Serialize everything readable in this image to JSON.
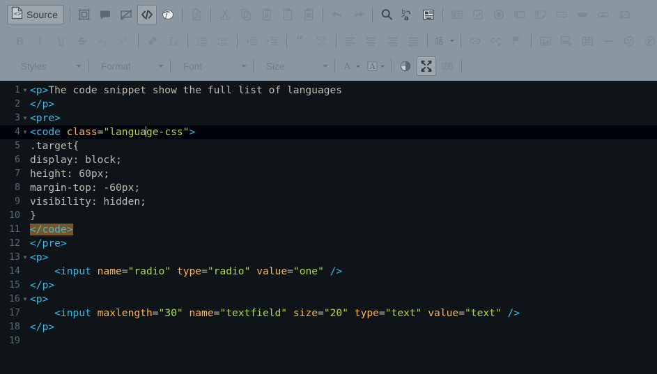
{
  "toolbar": {
    "source_button": {
      "label": "Source",
      "icon": "source-code-page-icon"
    },
    "row1": [
      {
        "name": "templates-icon",
        "state": "normal"
      },
      {
        "name": "comment-icon",
        "state": "normal"
      },
      {
        "name": "hide-comment-icon",
        "state": "normal"
      },
      {
        "name": "code-snippet-icon",
        "state": "active"
      },
      {
        "name": "mathjax-icon",
        "state": "normal"
      },
      {
        "name": "new-page-icon",
        "state": "disabled"
      },
      {
        "name": "cut-icon",
        "state": "disabled"
      },
      {
        "name": "copy-icon",
        "state": "disabled"
      },
      {
        "name": "paste-icon",
        "state": "disabled"
      },
      {
        "name": "paste-as-text-icon",
        "state": "disabled"
      },
      {
        "name": "paste-from-word-icon",
        "state": "disabled"
      },
      {
        "name": "undo-icon",
        "state": "disabled"
      },
      {
        "name": "redo-icon",
        "state": "disabled"
      },
      {
        "name": "find-icon",
        "state": "normal"
      },
      {
        "name": "replace-icon",
        "state": "normal"
      },
      {
        "name": "select-all-icon",
        "state": "normal"
      },
      {
        "name": "form-icon",
        "state": "disabled"
      },
      {
        "name": "checkbox-icon",
        "state": "disabled"
      },
      {
        "name": "radio-button-icon",
        "state": "disabled"
      },
      {
        "name": "text-field-icon",
        "state": "disabled"
      },
      {
        "name": "textarea-icon",
        "state": "disabled"
      },
      {
        "name": "select-field-icon",
        "state": "disabled"
      },
      {
        "name": "button-icon",
        "state": "disabled"
      },
      {
        "name": "image-button-icon",
        "state": "disabled"
      },
      {
        "name": "hidden-field-icon",
        "state": "disabled"
      }
    ],
    "row2": [
      {
        "name": "bold-icon",
        "label": "B",
        "state": "disabled"
      },
      {
        "name": "italic-icon",
        "label": "I",
        "state": "disabled"
      },
      {
        "name": "underline-icon",
        "label": "U",
        "state": "disabled"
      },
      {
        "name": "strikethrough-icon",
        "label": "S",
        "state": "disabled"
      },
      {
        "name": "subscript-icon",
        "state": "disabled"
      },
      {
        "name": "superscript-icon",
        "state": "disabled"
      },
      {
        "name": "copy-formatting-icon",
        "state": "disabled"
      },
      {
        "name": "remove-format-icon",
        "state": "disabled"
      },
      {
        "name": "numbered-list-icon",
        "state": "disabled"
      },
      {
        "name": "bulleted-list-icon",
        "state": "disabled"
      },
      {
        "name": "decrease-indent-icon",
        "state": "disabled"
      },
      {
        "name": "increase-indent-icon",
        "state": "disabled"
      },
      {
        "name": "blockquote-icon",
        "state": "disabled"
      },
      {
        "name": "create-div-icon",
        "state": "disabled"
      },
      {
        "name": "align-left-icon",
        "state": "disabled"
      },
      {
        "name": "align-center-icon",
        "state": "disabled"
      },
      {
        "name": "align-right-icon",
        "state": "disabled"
      },
      {
        "name": "justify-icon",
        "state": "disabled"
      },
      {
        "name": "language-icon",
        "state": "disabled"
      },
      {
        "name": "link-icon",
        "state": "disabled"
      },
      {
        "name": "unlink-icon",
        "state": "disabled"
      },
      {
        "name": "anchor-icon",
        "state": "disabled"
      },
      {
        "name": "image-icon",
        "state": "disabled"
      },
      {
        "name": "insert-media-icon",
        "state": "disabled"
      },
      {
        "name": "table-icon",
        "state": "disabled"
      },
      {
        "name": "horizontal-rule-icon",
        "state": "disabled"
      },
      {
        "name": "smiley-icon",
        "state": "disabled"
      },
      {
        "name": "special-character-icon",
        "state": "disabled"
      }
    ],
    "row3": {
      "combos": [
        {
          "name": "styles-combo",
          "label": "Styles"
        },
        {
          "name": "format-combo",
          "label": "Format"
        },
        {
          "name": "font-combo",
          "label": "Font"
        },
        {
          "name": "size-combo",
          "label": "Size"
        }
      ],
      "buttons": [
        {
          "name": "text-color-icon",
          "label": "A",
          "state": "disabled"
        },
        {
          "name": "background-color-icon",
          "label": "A",
          "state": "disabled"
        },
        {
          "name": "show-blocks-icon",
          "state": "normal"
        },
        {
          "name": "maximize-icon",
          "state": "active"
        },
        {
          "name": "about-icon",
          "state": "disabled"
        }
      ]
    }
  },
  "editor": {
    "name": "source-code-editor",
    "language": "html",
    "cursor": {
      "line": 4,
      "column": 21
    },
    "selection_text": "</code>",
    "lines": [
      {
        "number": "1",
        "fold": true,
        "active": false,
        "tokens": [
          {
            "t": "<p>",
            "c": "t-tag"
          },
          {
            "t": "The code snippet show the full list of languages",
            "c": "t-plain"
          }
        ]
      },
      {
        "number": "2",
        "fold": false,
        "active": false,
        "tokens": [
          {
            "t": "</p>",
            "c": "t-tag"
          }
        ]
      },
      {
        "number": "3",
        "fold": true,
        "active": false,
        "tokens": [
          {
            "t": "<pre>",
            "c": "t-tag"
          }
        ]
      },
      {
        "number": "4",
        "fold": true,
        "active": true,
        "tokens": [
          {
            "t": "<code ",
            "c": "t-tag"
          },
          {
            "t": "class",
            "c": "t-attr"
          },
          {
            "t": "=",
            "c": "t-eq"
          },
          {
            "t": "\"langua",
            "c": "t-str"
          },
          {
            "t": "|caret|",
            "c": "caret"
          },
          {
            "t": "ge-css\"",
            "c": "t-str"
          },
          {
            "t": ">",
            "c": "t-tag"
          }
        ]
      },
      {
        "number": "5",
        "fold": false,
        "active": false,
        "tokens": [
          {
            "t": ".target{",
            "c": "t-plain"
          }
        ]
      },
      {
        "number": "6",
        "fold": false,
        "active": false,
        "tokens": [
          {
            "t": "display: block;",
            "c": "t-plain"
          }
        ]
      },
      {
        "number": "7",
        "fold": false,
        "active": false,
        "tokens": [
          {
            "t": "height: 60px;",
            "c": "t-plain"
          }
        ]
      },
      {
        "number": "8",
        "fold": false,
        "active": false,
        "tokens": [
          {
            "t": "margin-top: -60px;",
            "c": "t-plain"
          }
        ]
      },
      {
        "number": "9",
        "fold": false,
        "active": false,
        "tokens": [
          {
            "t": "visibility: hidden;",
            "c": "t-plain"
          }
        ]
      },
      {
        "number": "10",
        "fold": false,
        "active": false,
        "tokens": [
          {
            "t": "}",
            "c": "t-plain"
          }
        ]
      },
      {
        "number": "11",
        "fold": false,
        "active": false,
        "tokens": [
          {
            "t": "</code>",
            "c": "t-tag t-sel"
          }
        ]
      },
      {
        "number": "12",
        "fold": false,
        "active": false,
        "tokens": [
          {
            "t": "</pre>",
            "c": "t-tag"
          }
        ]
      },
      {
        "number": "13",
        "fold": true,
        "active": false,
        "tokens": [
          {
            "t": "<p>",
            "c": "t-tag"
          }
        ]
      },
      {
        "number": "14",
        "fold": false,
        "active": false,
        "tokens": [
          {
            "t": "    <input ",
            "c": "t-tag"
          },
          {
            "t": "name",
            "c": "t-attr"
          },
          {
            "t": "=",
            "c": "t-eq"
          },
          {
            "t": "\"radio\"",
            "c": "t-str"
          },
          {
            "t": " ",
            "c": "t-plain"
          },
          {
            "t": "type",
            "c": "t-attr"
          },
          {
            "t": "=",
            "c": "t-eq"
          },
          {
            "t": "\"radio\"",
            "c": "t-str"
          },
          {
            "t": " ",
            "c": "t-plain"
          },
          {
            "t": "value",
            "c": "t-attr"
          },
          {
            "t": "=",
            "c": "t-eq"
          },
          {
            "t": "\"one\"",
            "c": "t-str"
          },
          {
            "t": " />",
            "c": "t-tag"
          }
        ]
      },
      {
        "number": "15",
        "fold": false,
        "active": false,
        "tokens": [
          {
            "t": "</p>",
            "c": "t-tag"
          }
        ]
      },
      {
        "number": "16",
        "fold": true,
        "active": false,
        "tokens": [
          {
            "t": "<p>",
            "c": "t-tag"
          }
        ]
      },
      {
        "number": "17",
        "fold": false,
        "active": false,
        "tokens": [
          {
            "t": "    <input ",
            "c": "t-tag"
          },
          {
            "t": "maxlength",
            "c": "t-attr"
          },
          {
            "t": "=",
            "c": "t-eq"
          },
          {
            "t": "\"30\"",
            "c": "t-str"
          },
          {
            "t": " ",
            "c": "t-plain"
          },
          {
            "t": "name",
            "c": "t-attr"
          },
          {
            "t": "=",
            "c": "t-eq"
          },
          {
            "t": "\"textfield\"",
            "c": "t-str"
          },
          {
            "t": " ",
            "c": "t-plain"
          },
          {
            "t": "size",
            "c": "t-attr"
          },
          {
            "t": "=",
            "c": "t-eq"
          },
          {
            "t": "\"20\"",
            "c": "t-str"
          },
          {
            "t": " ",
            "c": "t-plain"
          },
          {
            "t": "type",
            "c": "t-attr"
          },
          {
            "t": "=",
            "c": "t-eq"
          },
          {
            "t": "\"text\"",
            "c": "t-str"
          },
          {
            "t": " ",
            "c": "t-plain"
          },
          {
            "t": "value",
            "c": "t-attr"
          },
          {
            "t": "=",
            "c": "t-eq"
          },
          {
            "t": "\"text\"",
            "c": "t-str"
          },
          {
            "t": " />",
            "c": "t-tag"
          }
        ]
      },
      {
        "number": "18",
        "fold": false,
        "active": false,
        "tokens": [
          {
            "t": "</p>",
            "c": "t-tag"
          }
        ]
      },
      {
        "number": "19",
        "fold": false,
        "active": false,
        "tokens": []
      }
    ]
  },
  "colors": {
    "toolbar_bg": "#8a96a0",
    "editor_bg": "#0f1419",
    "active_line_bg": "#00030a",
    "tag": "#39bae6",
    "attribute": "#ffb454",
    "string": "#aad94c",
    "text": "#bfbab1",
    "gutter": "#5c6773",
    "selection": "#7a5722",
    "caret": "#e6b450"
  }
}
